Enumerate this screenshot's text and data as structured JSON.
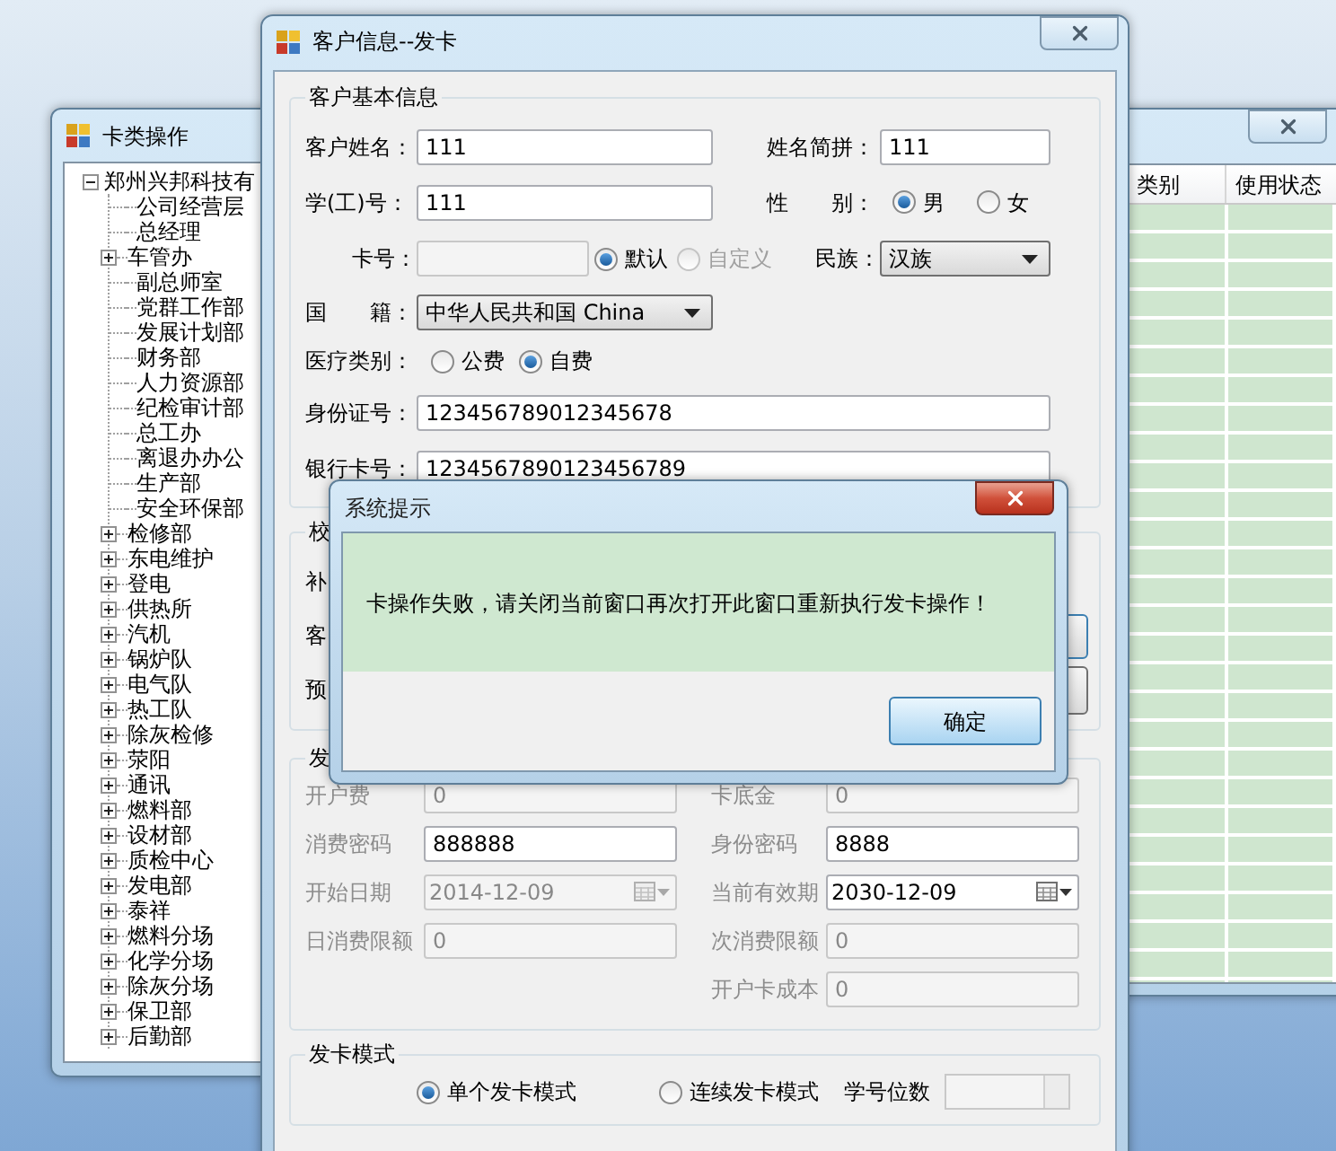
{
  "tree_window": {
    "title": "卡类操作",
    "tree": {
      "label": "郑州兴邦科技有",
      "expanded": true,
      "children": [
        {
          "label": "公司经营层",
          "expandable": false
        },
        {
          "label": "总经理",
          "expandable": false
        },
        {
          "label": "车管办",
          "expandable": true
        },
        {
          "label": "副总师室",
          "expandable": false
        },
        {
          "label": "党群工作部",
          "expandable": false
        },
        {
          "label": "发展计划部",
          "expandable": false
        },
        {
          "label": "财务部",
          "expandable": false
        },
        {
          "label": "人力资源部",
          "expandable": false
        },
        {
          "label": "纪检审计部",
          "expandable": false
        },
        {
          "label": "总工办",
          "expandable": false
        },
        {
          "label": "离退办办公",
          "expandable": false
        },
        {
          "label": "生产部",
          "expandable": false
        },
        {
          "label": "安全环保部",
          "expandable": false
        },
        {
          "label": "检修部",
          "expandable": true
        },
        {
          "label": "东电维护",
          "expandable": true
        },
        {
          "label": "登电",
          "expandable": true
        },
        {
          "label": "供热所",
          "expandable": true
        },
        {
          "label": "汽机",
          "expandable": true
        },
        {
          "label": "锅炉队",
          "expandable": true
        },
        {
          "label": "电气队",
          "expandable": true
        },
        {
          "label": "热工队",
          "expandable": true
        },
        {
          "label": "除灰检修",
          "expandable": true
        },
        {
          "label": "荥阳",
          "expandable": true
        },
        {
          "label": "通讯",
          "expandable": true
        },
        {
          "label": "燃料部",
          "expandable": true
        },
        {
          "label": "设材部",
          "expandable": true
        },
        {
          "label": "质检中心",
          "expandable": true
        },
        {
          "label": "发电部",
          "expandable": true
        },
        {
          "label": "泰祥",
          "expandable": true
        },
        {
          "label": "燃料分场",
          "expandable": true
        },
        {
          "label": "化学分场",
          "expandable": true
        },
        {
          "label": "除灰分场",
          "expandable": true
        },
        {
          "label": "保卫部",
          "expandable": true
        },
        {
          "label": "后勤部",
          "expandable": true
        }
      ]
    }
  },
  "list_window": {
    "columns": [
      "类别",
      "使用状态"
    ]
  },
  "customer_window": {
    "title": "客户信息--发卡",
    "basic_group": {
      "title": "客户基本信息",
      "name": {
        "label": "客户姓名：",
        "value": "111"
      },
      "pinyin": {
        "label": "姓名简拼：",
        "value": "111"
      },
      "staff_no": {
        "label": "学(工)号：",
        "value": "111"
      },
      "gender": {
        "label": "性　　别：",
        "options": [
          {
            "label": "男",
            "selected": true
          },
          {
            "label": "女",
            "selected": false
          }
        ]
      },
      "card_no": {
        "label": "卡号：",
        "disabled": true,
        "options": [
          {
            "label": "默认",
            "selected": true,
            "disabled": false
          },
          {
            "label": "自定义",
            "selected": false,
            "disabled": true
          }
        ]
      },
      "ethnicity": {
        "label": "民族：",
        "value": "汉族"
      },
      "nationality": {
        "label": "国　　籍：",
        "value": "中华人民共和国 China"
      },
      "medical": {
        "label": "医疗类别：",
        "options": [
          {
            "label": "公费",
            "selected": false
          },
          {
            "label": "自费",
            "selected": true
          }
        ]
      },
      "id_card": {
        "label": "身份证号：",
        "value": "123456789012345678"
      },
      "bank_card": {
        "label": "银行卡号：",
        "value": "1234567890123456789"
      }
    },
    "check_group": {
      "title": "校",
      "labels": [
        "补",
        "客",
        "预"
      ]
    },
    "issue_group": {
      "title": "发",
      "fields": [
        {
          "kind": "text",
          "label": "开户费",
          "value": "0",
          "disabled": true
        },
        {
          "kind": "text",
          "label": "卡底金",
          "value": "0",
          "disabled": true
        },
        {
          "kind": "text",
          "label": "消费密码",
          "value": "888888",
          "disabled": false
        },
        {
          "kind": "text",
          "label": "身份密码",
          "value": "8888",
          "disabled": false
        },
        {
          "kind": "date",
          "label": "开始日期",
          "value": "2014-12-09",
          "disabled": true
        },
        {
          "kind": "date",
          "label": "当前有效期",
          "value": "2030-12-09",
          "disabled": false
        },
        {
          "kind": "text",
          "label": "日消费限额",
          "value": "0",
          "disabled": true
        },
        {
          "kind": "text",
          "label": "次消费限额",
          "value": "0",
          "disabled": true
        },
        {
          "kind": "blank"
        },
        {
          "kind": "text",
          "label": "开户卡成本",
          "value": "0",
          "disabled": true
        }
      ]
    },
    "mode_group": {
      "title": "发卡模式",
      "options": [
        {
          "label": "单个发卡模式",
          "selected": true
        },
        {
          "label": "连续发卡模式",
          "selected": false
        }
      ],
      "digits_label": "学号位数"
    }
  },
  "dialog": {
    "title": "系统提示",
    "message": "卡操作失败，请关闭当前窗口再次打开此窗口重新执行发卡操作！",
    "button": "确定"
  }
}
